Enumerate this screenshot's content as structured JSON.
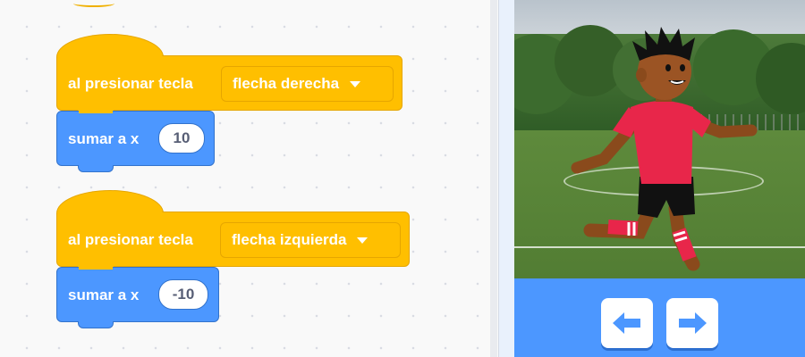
{
  "scripts": [
    {
      "event_label": "al presionar tecla",
      "key_option": "flecha derecha",
      "action_label": "sumar a x",
      "action_value": "10"
    },
    {
      "event_label": "al presionar tecla",
      "key_option": "flecha izquierda",
      "action_label": "sumar a x",
      "action_value": "-10"
    }
  ],
  "stage": {
    "sprite": "soccer-player",
    "backdrop": "soccer-field",
    "controls": [
      {
        "icon": "arrow-left-icon"
      },
      {
        "icon": "arrow-right-icon"
      }
    ]
  },
  "colors": {
    "events": "#ffbf00",
    "motion": "#4c97ff",
    "controls_bar": "#4c97ff",
    "shirt": "#e8264a"
  }
}
